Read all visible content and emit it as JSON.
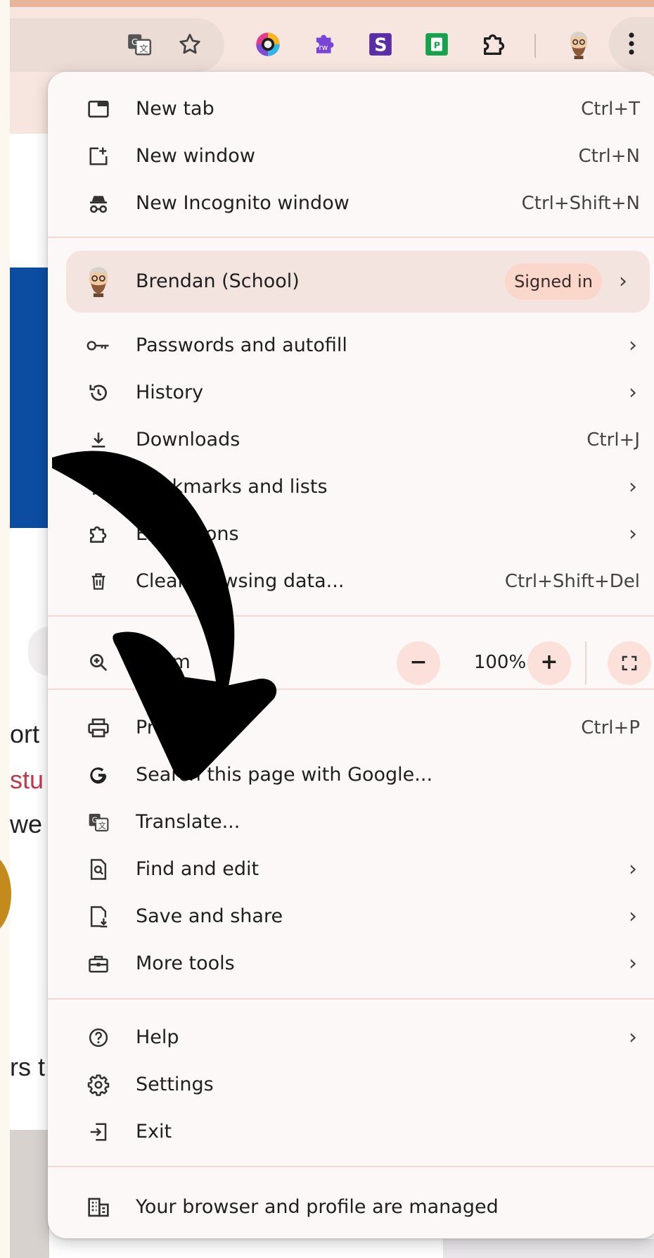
{
  "toolbar": {
    "icons": [
      "translate-icon",
      "bookmark-star-icon",
      "colorful-extension-icon",
      "rw-extension-icon",
      "s-extension-icon",
      "green-extension-icon",
      "extensions-puzzle-icon",
      "profile-avatar-icon",
      "more-menu-icon"
    ]
  },
  "background_page": {
    "fragments": [
      "ort",
      "stu",
      "we",
      "rs t"
    ]
  },
  "menu": {
    "items_group1": [
      {
        "label": "New tab",
        "shortcut": "Ctrl+T",
        "icon": "new-tab-icon"
      },
      {
        "label": "New window",
        "shortcut": "Ctrl+N",
        "icon": "new-window-icon"
      },
      {
        "label": "New Incognito window",
        "shortcut": "Ctrl+Shift+N",
        "icon": "incognito-icon"
      }
    ],
    "profile": {
      "name": "Brendan (School)",
      "status": "Signed in",
      "icon": "profile-avatar-icon"
    },
    "items_group2": [
      {
        "label": "Passwords and autofill",
        "icon": "key-icon"
      },
      {
        "label": "History",
        "icon": "history-icon"
      },
      {
        "label": "Downloads",
        "shortcut": "Ctrl+J",
        "icon": "download-icon"
      },
      {
        "label": "Bookmarks and lists",
        "icon": "star-icon"
      },
      {
        "label": "Extensions",
        "icon": "puzzle-icon"
      },
      {
        "label": "Clear browsing data...",
        "shortcut": "Ctrl+Shift+Del",
        "icon": "trash-icon"
      }
    ],
    "zoom": {
      "label": "Zoom",
      "minus": "−",
      "value": "100%",
      "plus": "+",
      "icon": "zoom-icon"
    },
    "items_group3": [
      {
        "label": "Print...",
        "shortcut": "Ctrl+P",
        "icon": "print-icon"
      },
      {
        "label": "Search this page with Google...",
        "icon": "google-g-icon"
      },
      {
        "label": "Translate...",
        "icon": "translate-icon"
      },
      {
        "label": "Find and edit",
        "icon": "find-icon"
      },
      {
        "label": "Save and share",
        "icon": "save-share-icon"
      },
      {
        "label": "More tools",
        "icon": "toolbox-icon"
      }
    ],
    "items_group4": [
      {
        "label": "Help",
        "icon": "help-icon"
      },
      {
        "label": "Settings",
        "icon": "settings-gear-icon"
      },
      {
        "label": "Exit",
        "icon": "exit-icon"
      }
    ],
    "managed": {
      "label": "Your browser and profile are managed",
      "icon": "managed-building-icon"
    },
    "arrow_glyph": "›"
  }
}
